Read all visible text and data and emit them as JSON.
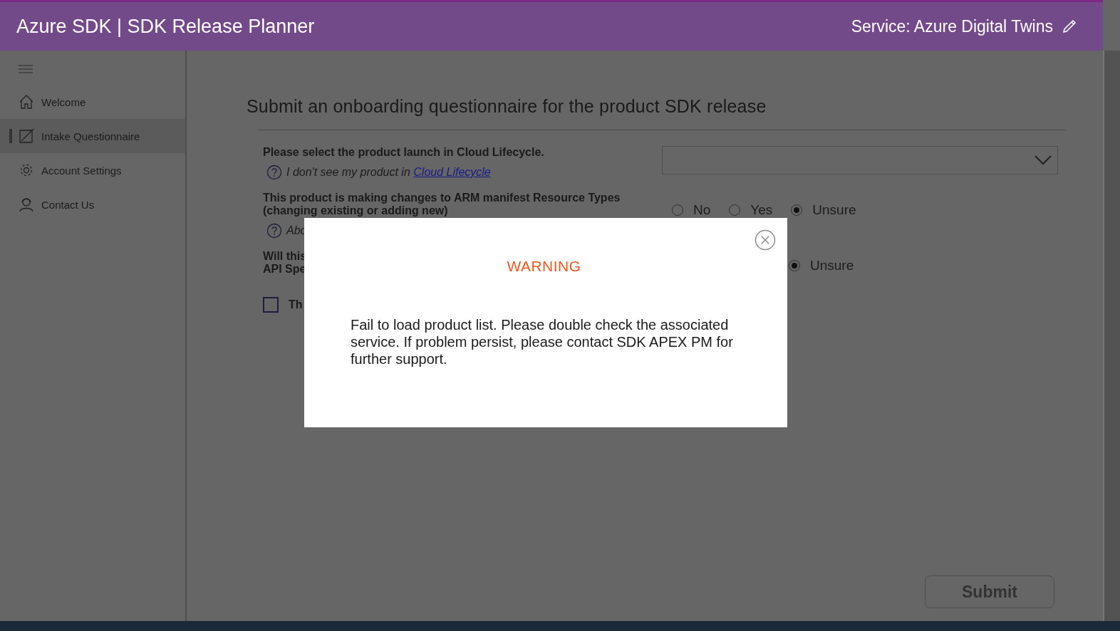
{
  "header": {
    "title": "Azure SDK | SDK Release Planner",
    "service": "Service: Azure Digital Twins"
  },
  "sidebar": {
    "items": [
      {
        "label": "Welcome",
        "selected": false
      },
      {
        "label": "Intake Questionnaire",
        "selected": true
      },
      {
        "label": "Account Settings",
        "selected": false
      },
      {
        "label": "Contact Us",
        "selected": false
      }
    ]
  },
  "page_title": "Submit an onboarding questionnaire for the product SDK release",
  "questions": [
    {
      "kind": "dropdown",
      "label": "Please select the product launch in Cloud Lifecycle.",
      "help": "I don't see my product in ",
      "help_link": "Cloud Lifecycle"
    },
    {
      "kind": "radio",
      "label": "This product is making changes to ARM manifest Resource Types (changing existing or adding new)",
      "help": "Abo",
      "options": [
        {
          "label": "No",
          "selected": false
        },
        {
          "label": "Yes",
          "selected": false
        },
        {
          "label": "Unsure",
          "selected": true
        }
      ]
    },
    {
      "kind": "radio",
      "label": "Will this\nAPI Spe",
      "options": [
        {
          "label": "Unsure",
          "selected": true
        }
      ]
    },
    {
      "kind": "checkbox",
      "label": "Th",
      "checked": false
    }
  ],
  "submit": {
    "label": "Submit",
    "disabled": true
  },
  "dialog": {
    "title": "WARNING",
    "message": "Fail to load product list. Please double check the associated service. If problem persist, please contact SDK APEX PM for further support."
  }
}
